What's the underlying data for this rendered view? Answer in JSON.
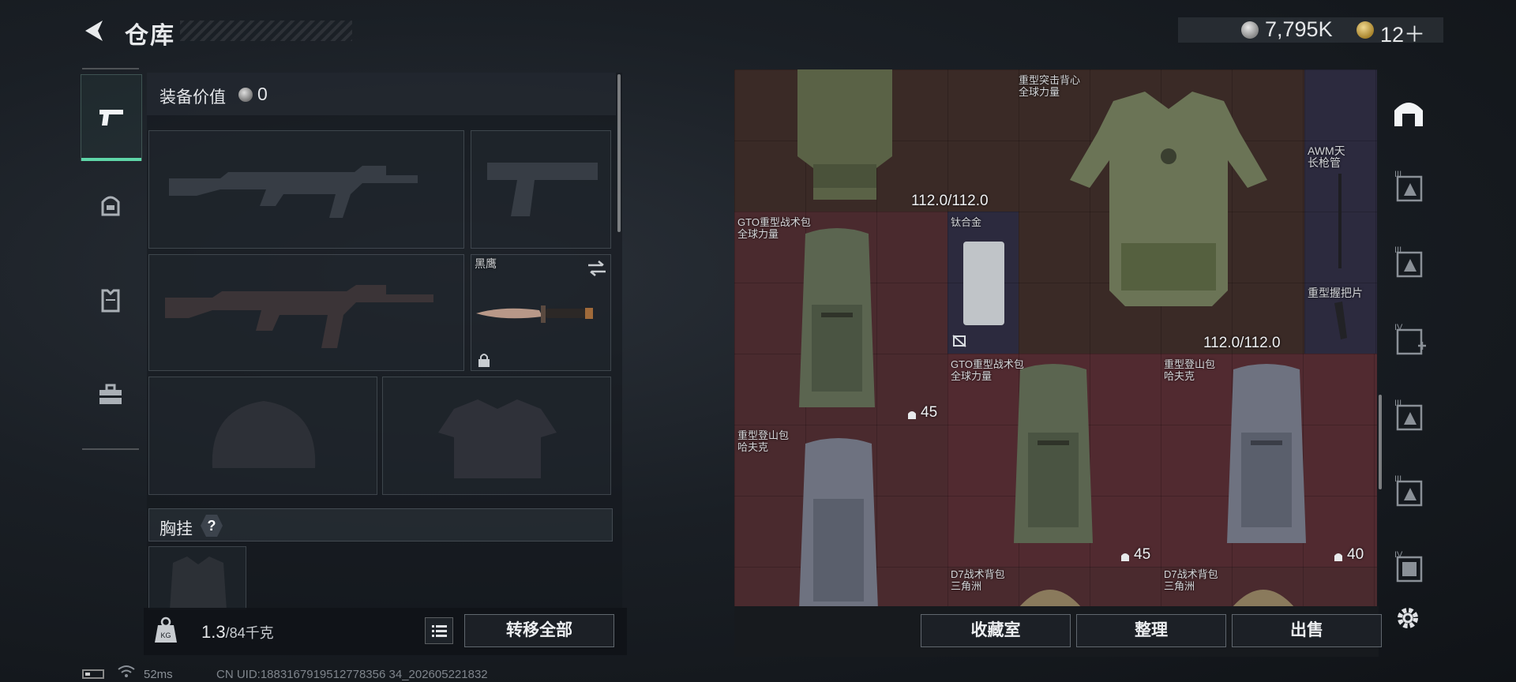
{
  "header": {
    "title": "仓库",
    "currency_silver": "7,795K",
    "currency_gold": "12＋"
  },
  "loadout": {
    "value_label": "装备价值",
    "value": "0",
    "knife_name": "黑鹰",
    "chest_label": "胸挂",
    "chest_help": "?"
  },
  "bottom": {
    "weight_current": "1.3",
    "weight_max": "/84千克",
    "transfer_all": "转移全部"
  },
  "status": {
    "ping": "52ms",
    "uid": "CN UID:1883167919512778356 34_202605221832"
  },
  "stash": {
    "items": [
      {
        "name": "重型突击背心\n全球力量",
        "durability": "112.0/112.0"
      },
      {
        "name": "",
        "durability": "112.0/112.0"
      },
      {
        "name": "AWM天\n长枪管"
      },
      {
        "name": "重型握把片"
      },
      {
        "name": "GTO重型战术包\n全球力量",
        "count": "45"
      },
      {
        "name": "钛合金"
      },
      {
        "name": "GTO重型战术包\n全球力量",
        "count": "45"
      },
      {
        "name": "重型登山包\n哈夫克",
        "count": "40"
      },
      {
        "name": "重型登山包\n哈夫克"
      },
      {
        "name": "D7战术背包\n三角洲"
      },
      {
        "name": "D7战术背包\n三角洲"
      }
    ],
    "buttons": {
      "collection": "收藏室",
      "sort": "整理",
      "sell": "出售"
    }
  },
  "colors": {
    "accent": "#5fd6a8",
    "stash_red": "#4a2a2e",
    "stash_purple": "#2c2a3e"
  }
}
